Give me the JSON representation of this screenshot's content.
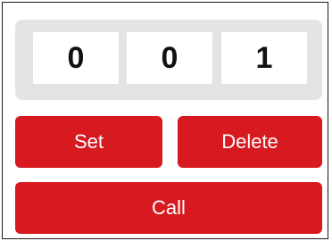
{
  "display": {
    "digits": [
      "0",
      "0",
      "1"
    ]
  },
  "buttons": {
    "set_label": "Set",
    "delete_label": "Delete",
    "call_label": "Call"
  },
  "colors": {
    "accent": "#d71920",
    "panel": "#e4e4e4",
    "digit_bg": "#ffffff",
    "digit_text": "#111111"
  }
}
